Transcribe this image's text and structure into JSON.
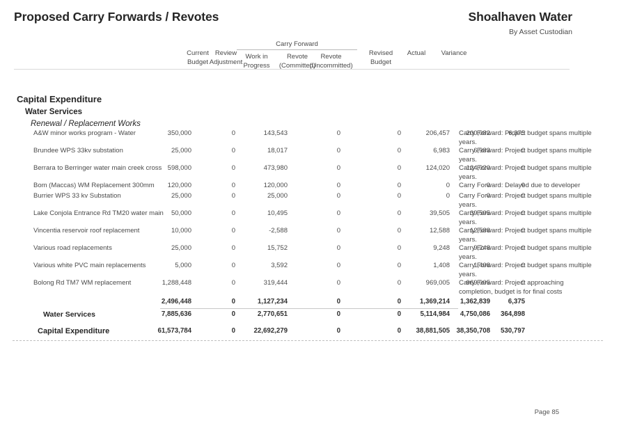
{
  "header": {
    "doc_title": "Proposed Carry Forwards / Revotes",
    "org_title": "Shoalhaven Water",
    "org_subtitle": "By Asset Custodian"
  },
  "columns": {
    "current_budget_l1": "Current",
    "current_budget_l2": "Budget",
    "review_adjustment_l1": "Review",
    "review_adjustment_l2": "Adjustment",
    "carry_forward_group": "Carry Forward",
    "work_in_progress_l1": "Work in",
    "work_in_progress_l2": "Progress",
    "revote_committed_l1": "Revote",
    "revote_committed_l2": "(Committed)",
    "revote_uncommitted_l1": "Revote",
    "revote_uncommitted_l2": "(Uncommitted)",
    "revised_budget_l1": "Revised",
    "revised_budget_l2": "Budget",
    "actual": "Actual",
    "variance": "Variance"
  },
  "sections": {
    "level1": "Capital Expenditure",
    "level2": "Water Services",
    "level3": "Renewal / Replacement Works"
  },
  "rows": [
    {
      "description": "A&W minor works program - Water",
      "current_budget": "350,000",
      "review_adjustment": "0",
      "work_in_progress": "143,543",
      "revote_committed": "0",
      "revote_uncommitted": "0",
      "revised_budget": "206,457",
      "actual": "200,082",
      "variance": "6,375",
      "note": "Carry Forward: Project budget spans multiple years."
    },
    {
      "description": "Brundee WPS 33kv substation",
      "current_budget": "25,000",
      "review_adjustment": "0",
      "work_in_progress": "18,017",
      "revote_committed": "0",
      "revote_uncommitted": "0",
      "revised_budget": "6,983",
      "actual": "6,983",
      "variance": "0",
      "note": "Carry Forward: Project budget spans multiple years."
    },
    {
      "description": "Berrara to Berringer water main creek cross",
      "current_budget": "598,000",
      "review_adjustment": "0",
      "work_in_progress": "473,980",
      "revote_committed": "0",
      "revote_uncommitted": "0",
      "revised_budget": "124,020",
      "actual": "124,020",
      "variance": "0",
      "note": "Carry Forward: Project budget spans multiple years."
    },
    {
      "description": "Bom (Maccas) WM Replacement 300mm",
      "current_budget": "120,000",
      "review_adjustment": "0",
      "work_in_progress": "120,000",
      "revote_committed": "0",
      "revote_uncommitted": "0",
      "revised_budget": "0",
      "actual": "0",
      "variance": "0",
      "note": "Carry Forward: Delayed due to developer"
    },
    {
      "description": "Burrier WPS 33 kv Substation",
      "current_budget": "25,000",
      "review_adjustment": "0",
      "work_in_progress": "25,000",
      "revote_committed": "0",
      "revote_uncommitted": "0",
      "revised_budget": "0",
      "actual": "0",
      "variance": "0",
      "note": "Carry Forward: Project budget spans multiple years."
    },
    {
      "description": "Lake Conjola Entrance Rd TM20 water main",
      "current_budget": "50,000",
      "review_adjustment": "0",
      "work_in_progress": "10,495",
      "revote_committed": "0",
      "revote_uncommitted": "0",
      "revised_budget": "39,505",
      "actual": "39,505",
      "variance": "0",
      "note": "Carry Forward: Project budget spans multiple years."
    },
    {
      "description": "Vincentia reservoir roof replacement",
      "current_budget": "10,000",
      "review_adjustment": "0",
      "work_in_progress": "-2,588",
      "revote_committed": "0",
      "revote_uncommitted": "0",
      "revised_budget": "12,588",
      "actual": "12,588",
      "variance": "0",
      "note": "Carry Forward: Project budget spans multiple years."
    },
    {
      "description": "Various road replacements",
      "current_budget": "25,000",
      "review_adjustment": "0",
      "work_in_progress": "15,752",
      "revote_committed": "0",
      "revote_uncommitted": "0",
      "revised_budget": "9,248",
      "actual": "9,248",
      "variance": "0",
      "note": "Carry Forward: Project budget spans multiple years."
    },
    {
      "description": "Various white PVC main replacements",
      "current_budget": "5,000",
      "review_adjustment": "0",
      "work_in_progress": "3,592",
      "revote_committed": "0",
      "revote_uncommitted": "0",
      "revised_budget": "1,408",
      "actual": "1,408",
      "variance": "0",
      "note": "Carry Forward: Project budget spans multiple years."
    },
    {
      "description": "Bolong Rd TM7 WM replacement",
      "current_budget": "1,288,448",
      "review_adjustment": "0",
      "work_in_progress": "319,444",
      "revote_committed": "0",
      "revote_uncommitted": "0",
      "revised_budget": "969,005",
      "actual": "969,005",
      "variance": "0",
      "note": "Carry Forward: Project approaching completion, budget is for final costs"
    }
  ],
  "totals": {
    "group_subtotal": {
      "label": "",
      "current_budget": "2,496,448",
      "review_adjustment": "0",
      "work_in_progress": "1,127,234",
      "revote_committed": "0",
      "revote_uncommitted": "0",
      "revised_budget": "1,369,214",
      "actual": "1,362,839",
      "variance": "6,375"
    },
    "water_services": {
      "label": "Water Services",
      "current_budget": "7,885,636",
      "review_adjustment": "0",
      "work_in_progress": "2,770,651",
      "revote_committed": "0",
      "revote_uncommitted": "0",
      "revised_budget": "5,114,984",
      "actual": "4,750,086",
      "variance": "364,898"
    },
    "capital_expenditure": {
      "label": "Capital Expenditure",
      "current_budget": "61,573,784",
      "review_adjustment": "0",
      "work_in_progress": "22,692,279",
      "revote_committed": "0",
      "revote_uncommitted": "0",
      "revised_budget": "38,881,505",
      "actual": "38,350,708",
      "variance": "530,797"
    }
  },
  "footer": {
    "page_label": "Page 85"
  }
}
